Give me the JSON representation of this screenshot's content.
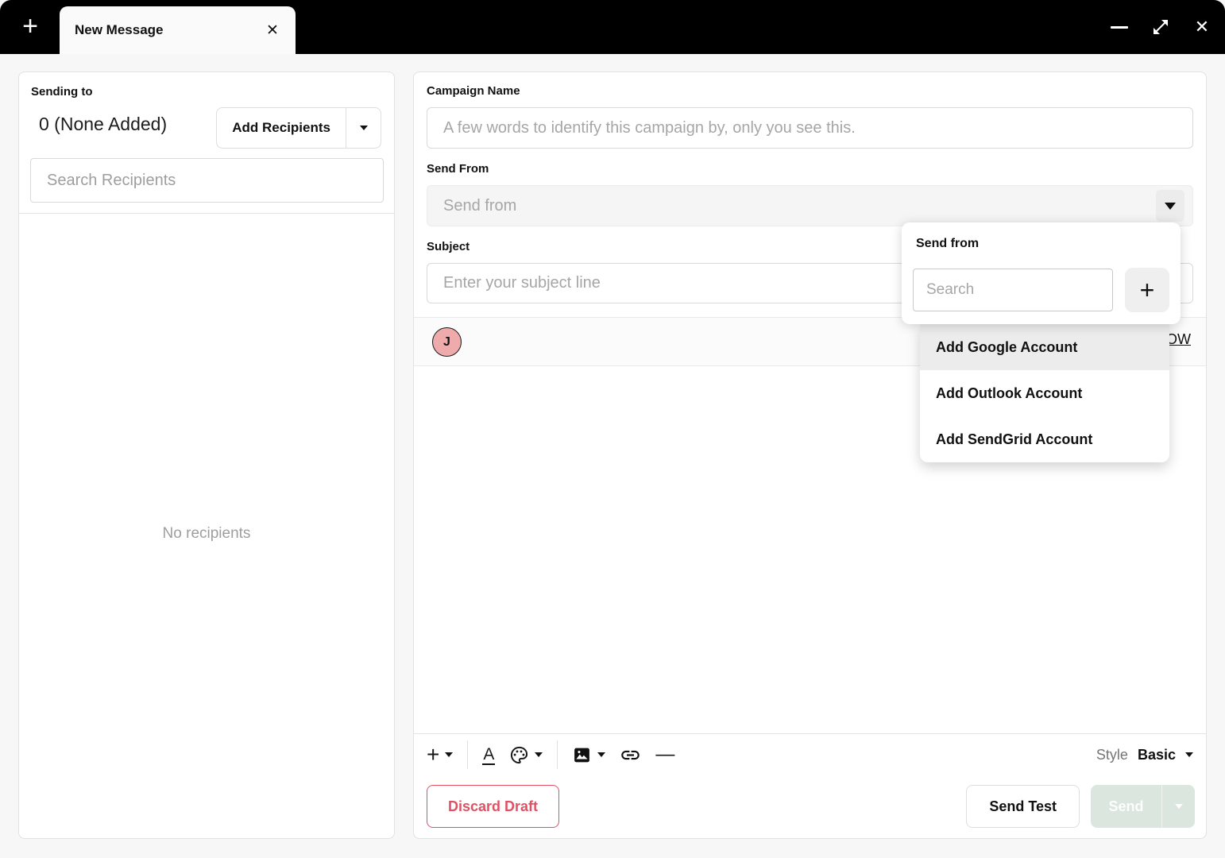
{
  "colors": {
    "accent_red": "#e05263",
    "send_disabled_bg": "#dbe6df",
    "avatar_bg": "#efabab",
    "titlebar_bg": "#000000",
    "highlight_gray": "#ececec"
  },
  "titlebar": {
    "tab_title": "New Message"
  },
  "icons": {
    "new_tab_plus": "+",
    "tab_close": "✕",
    "window_close": "✕",
    "insert_plus": "+",
    "text_color_letter": "A",
    "horizontal_rule": "—",
    "add_account_plus": "+"
  },
  "recipients_panel": {
    "sending_to_label": "Sending to",
    "count_text": "0 (None Added)",
    "add_recipients_label": "Add Recipients",
    "search_placeholder": "Search Recipients",
    "empty_text": "No recipients"
  },
  "compose": {
    "campaign_name_label": "Campaign Name",
    "campaign_name_placeholder": "A few words to identify this campaign by, only you see this.",
    "send_from_label": "Send From",
    "send_from_placeholder": "Send from",
    "subject_label": "Subject",
    "subject_placeholder": "Enter your subject line",
    "avatar_initial": "J",
    "followup_partial_text": "OW"
  },
  "send_from_popover": {
    "title": "Send from",
    "search_placeholder": "Search",
    "menu_items": [
      "Add Google Account",
      "Add Outlook Account",
      "Add SendGrid Account"
    ]
  },
  "footer": {
    "style_label": "Style",
    "style_value": "Basic",
    "discard_label": "Discard Draft",
    "send_test_label": "Send Test",
    "send_label": "Send"
  }
}
